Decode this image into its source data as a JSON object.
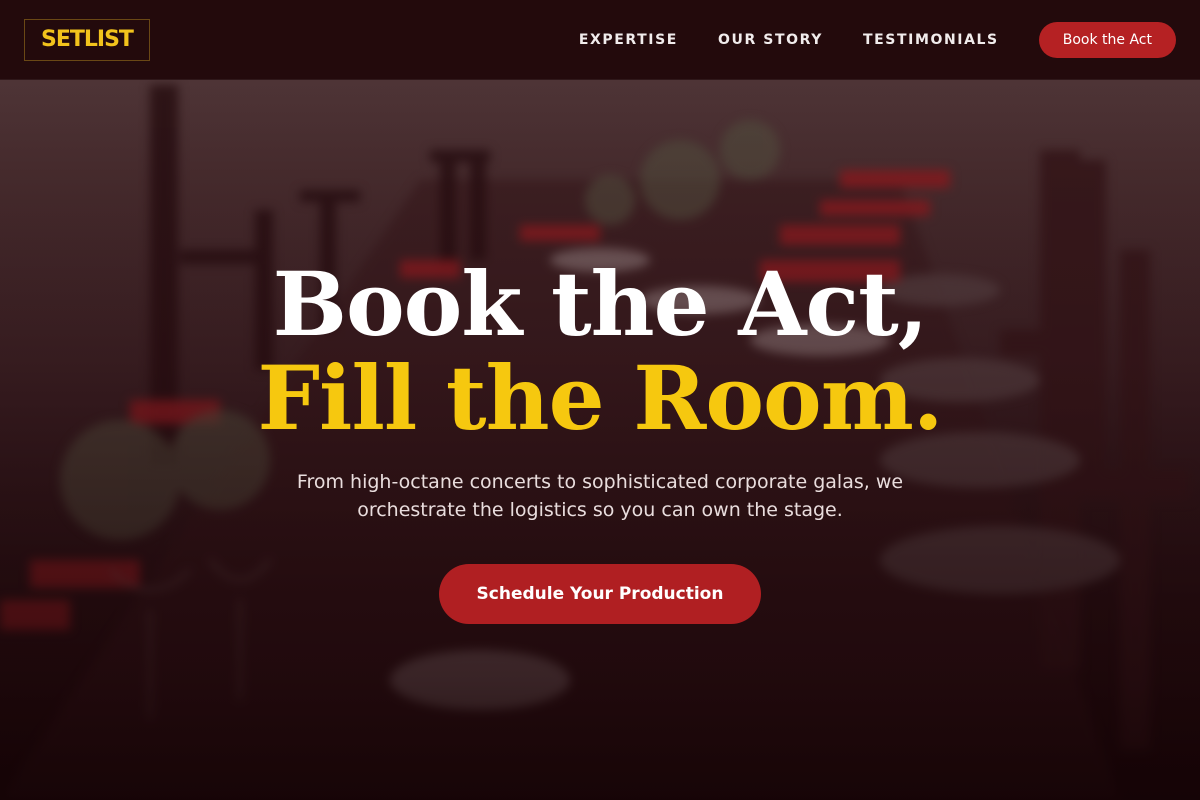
{
  "header": {
    "logo": "SETLIST",
    "nav": [
      {
        "label": "EXPERTISE"
      },
      {
        "label": "OUR STORY"
      },
      {
        "label": "TESTIMONIALS"
      }
    ],
    "cta_label": "Book the Act"
  },
  "hero": {
    "headline_line1": "Book the Act,",
    "headline_line2": "Fill the Room.",
    "subtitle": "From high-octane concerts to sophisticated corporate galas, we orchestrate the logistics so you can own the stage.",
    "cta_label": "Schedule Your Production"
  },
  "colors": {
    "accent_red": "#b01f22",
    "accent_gold": "#f6c80f",
    "header_bg": "#230a0c"
  }
}
